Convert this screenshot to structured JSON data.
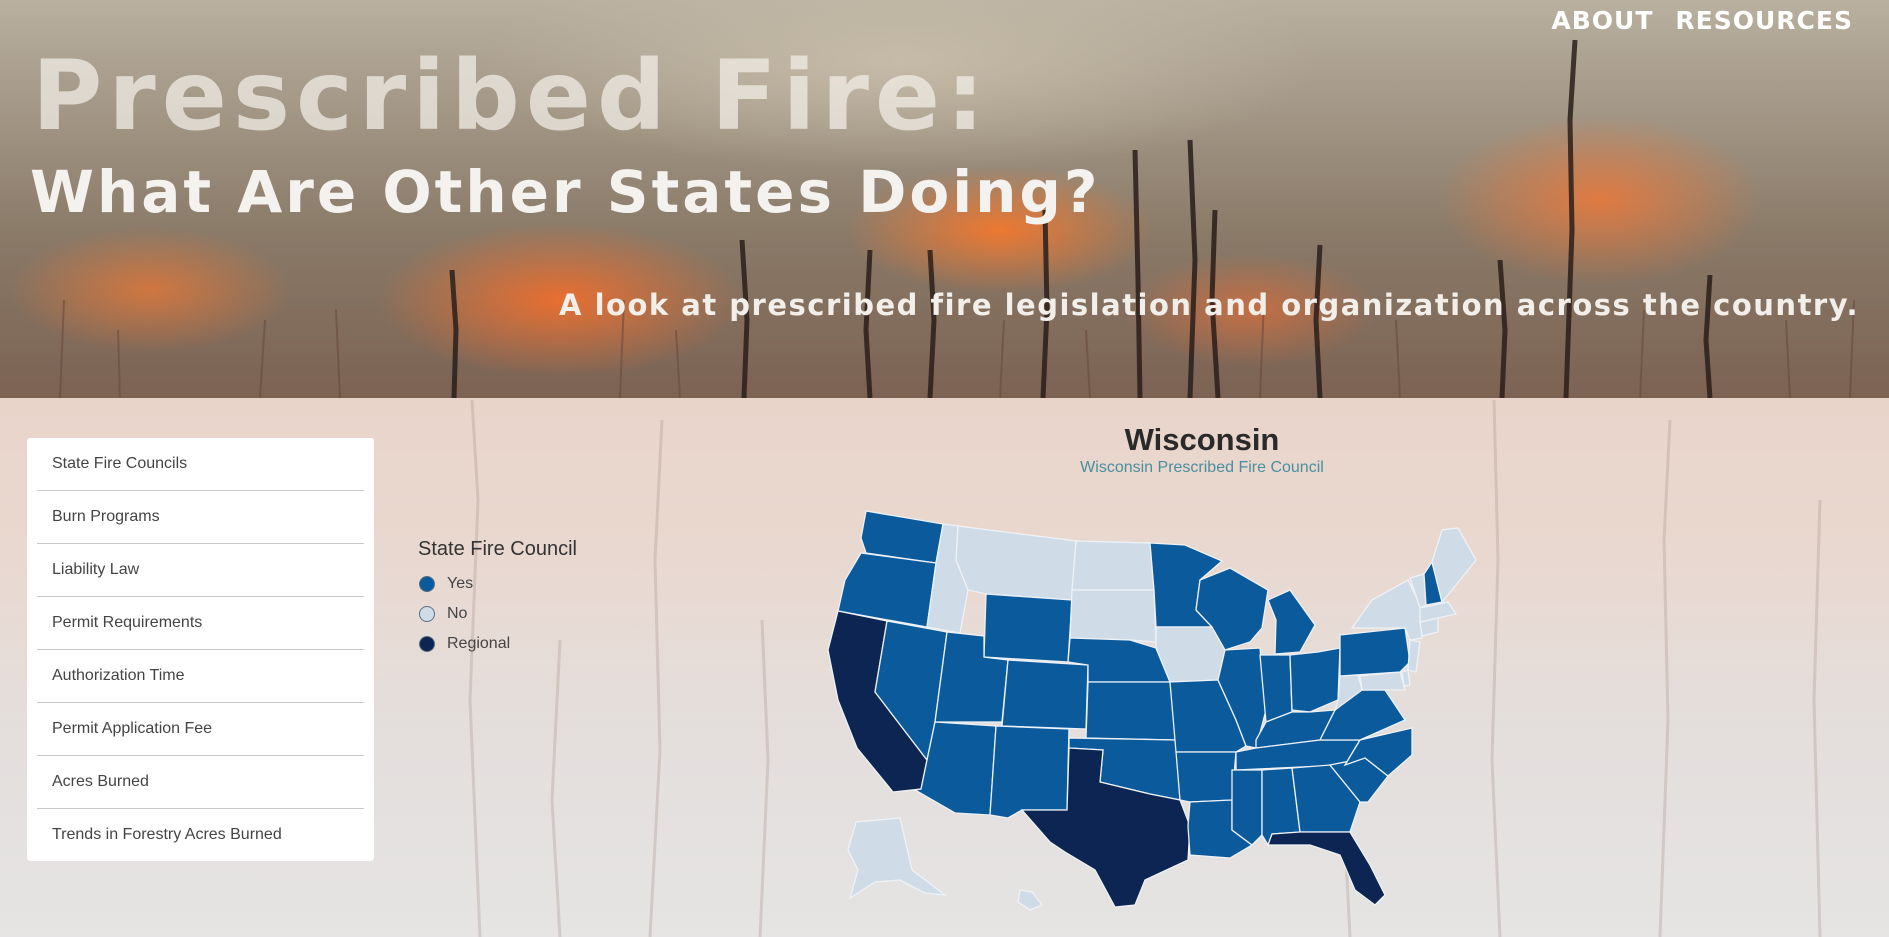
{
  "nav": {
    "about": "ABOUT",
    "resources": "RESOURCES"
  },
  "hero": {
    "title_line1": "Prescribed Fire:",
    "title_line2": "What Are Other States Doing?",
    "subtitle": "A look at prescribed fire legislation and organization across the country."
  },
  "menu": {
    "items": [
      "State Fire Councils",
      "Burn Programs",
      "Liability Law",
      "Permit Requirements",
      "Authorization Time",
      "Permit Application Fee",
      "Acres Burned",
      "Trends in Forestry Acres Burned"
    ]
  },
  "legend": {
    "title": "State Fire Council",
    "items": [
      {
        "label": "Yes",
        "color": "#0a5a9c"
      },
      {
        "label": "No",
        "color": "#cfdbe6"
      },
      {
        "label": "Regional",
        "color": "#0c2552"
      }
    ]
  },
  "selected": {
    "state": "Wisconsin",
    "council": "Wisconsin Prescribed Fire Council"
  },
  "map_colors": {
    "yes": "#0a5a9c",
    "no": "#cfdbe6",
    "regional": "#0c2552",
    "border": "#eef2f6"
  }
}
